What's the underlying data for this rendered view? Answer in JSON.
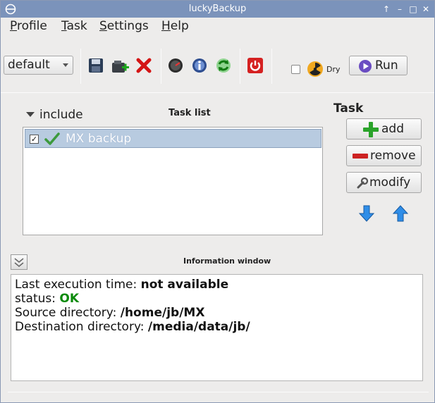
{
  "window": {
    "title": "luckyBackup",
    "controls": {
      "up": "↑",
      "minimize": "–",
      "maximize": "□",
      "close": "✕"
    }
  },
  "menubar": {
    "items": [
      "Profile",
      "Task",
      "Settings",
      "Help"
    ]
  },
  "toolbar": {
    "profile_combo_value": "default",
    "icons": [
      "save-icon",
      "add-profile-icon",
      "delete-icon",
      "schedule-icon",
      "info-icon",
      "refresh-icon",
      "power-icon"
    ],
    "dry_label": "Dry",
    "run_label": "Run"
  },
  "tasklist": {
    "include_label": "include",
    "title": "Task list",
    "rows": [
      {
        "name": "MX backup",
        "checked": true,
        "status_icon": "ok-check-icon"
      }
    ]
  },
  "task_panel": {
    "header": "Task",
    "add_label": "add",
    "remove_label": "remove",
    "modify_label": "modify"
  },
  "info": {
    "title": "Information window",
    "lines": [
      {
        "label": "Last execution time: ",
        "value": "not available"
      },
      {
        "label": "status: ",
        "value": "OK"
      },
      {
        "label": "Source directory: ",
        "value": "/home/jb/MX"
      },
      {
        "label": "Destination directory: ",
        "value": "/media/data/jb/"
      }
    ]
  },
  "colors": {
    "titlebar": "#7b93bb",
    "selection": "#b8cbe0",
    "status_ok": "#0a8a0a"
  }
}
